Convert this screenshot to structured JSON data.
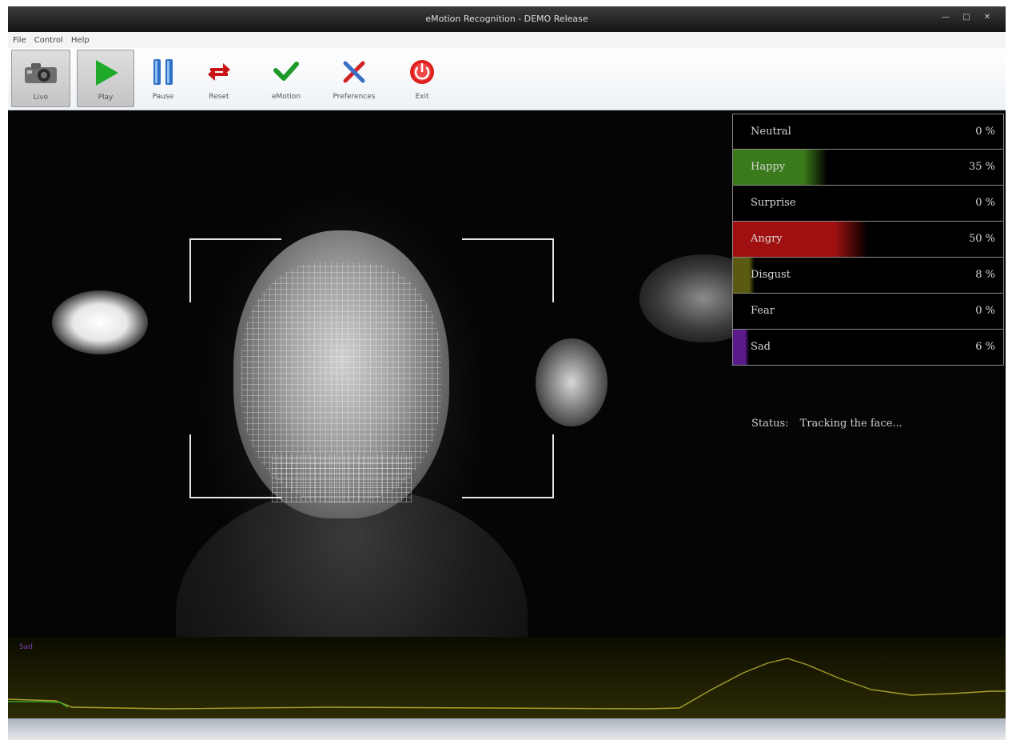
{
  "window": {
    "title": "eMotion Recognition - DEMO Release"
  },
  "menu": [
    "File",
    "Control",
    "Help"
  ],
  "toolbar": {
    "live": "Live",
    "play": "Play",
    "pause": "Pause",
    "reset": "Reset",
    "emotion": "eMotion",
    "preferences": "Preferences",
    "exit": "Exit"
  },
  "emotions": [
    {
      "name": "Neutral",
      "percent": "0 %",
      "value": 0,
      "color": "#000000"
    },
    {
      "name": "Happy",
      "percent": "35 %",
      "value": 35,
      "color": "#3a7a1a"
    },
    {
      "name": "Surprise",
      "percent": "0 %",
      "value": 0,
      "color": "#000000"
    },
    {
      "name": "Angry",
      "percent": "50 %",
      "value": 50,
      "color": "#a01010"
    },
    {
      "name": "Disgust",
      "percent": "8 %",
      "value": 8,
      "color": "#5a5a12"
    },
    {
      "name": "Fear",
      "percent": "0 %",
      "value": 0,
      "color": "#000000"
    },
    {
      "name": "Sad",
      "percent": "6 %",
      "value": 6,
      "color": "#5a1a8a"
    }
  ],
  "status": {
    "label": "Status:",
    "text": "Tracking the face..."
  },
  "graph": {
    "label": "Sad"
  }
}
